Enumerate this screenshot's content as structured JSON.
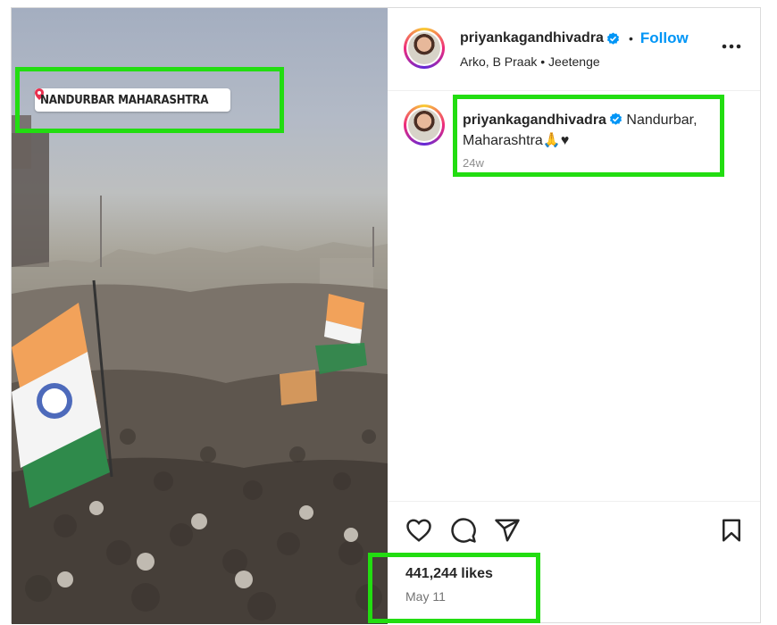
{
  "post": {
    "location_tag": "NANDURBAR MAHARASHTRA",
    "username": "priyankagandhivadra",
    "follow_label": "Follow",
    "separator": "•",
    "audio": "Arko, B Praak • Jeetenge",
    "caption": "Nandurbar, Maharashtra🙏♥",
    "caption_time": "24w",
    "likes": "441,244 likes",
    "date": "May 11"
  },
  "colors": {
    "follow": "#0095f6",
    "verified_badge": "#0095f6",
    "highlight": "#22dd11",
    "muted_text": "#8e8e8e"
  },
  "icons": {
    "verified": "verified-badge-icon",
    "more": "more-options-icon",
    "like": "heart-icon",
    "comment": "comment-icon",
    "share": "share-icon",
    "save": "bookmark-icon",
    "location": "location-pin-icon"
  }
}
